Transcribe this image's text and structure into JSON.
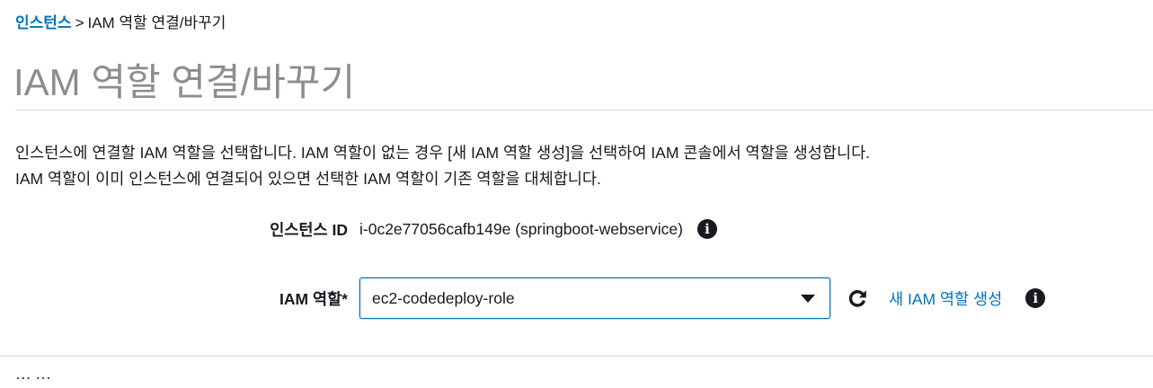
{
  "breadcrumb": {
    "link": "인스턴스",
    "separator": ">",
    "current": "IAM 역할 연결/바꾸기"
  },
  "page": {
    "title": "IAM 역할 연결/바꾸기"
  },
  "description": {
    "line1": "인스턴스에 연결할 IAM 역할을 선택합니다. IAM 역할이 없는 경우 [새 IAM 역할 생성]을 선택하여 IAM 콘솔에서 역할을 생성합니다.",
    "line2": "IAM 역할이 이미 인스턴스에 연결되어 있으면 선택한 IAM 역할이 기존 역할을 대체합니다."
  },
  "instance": {
    "label": "인스턴스 ID",
    "value": "i-0c2e77056cafb149e (springboot-webservice)",
    "info_icon": "info-icon"
  },
  "iam_role": {
    "label": "IAM 역할*",
    "selected": "ec2-codedeploy-role",
    "dropdown_icon": "caret-down-icon",
    "refresh_icon": "refresh-icon",
    "create_link": "새 IAM 역할 생성",
    "info_icon": "info-icon"
  },
  "footer": {
    "cut_text": "··· ···"
  },
  "colors": {
    "link": "#0073bb",
    "title": "#8a8d91",
    "text": "#16191f",
    "divider": "#d5dbdb",
    "focus_border": "#0073bb"
  }
}
